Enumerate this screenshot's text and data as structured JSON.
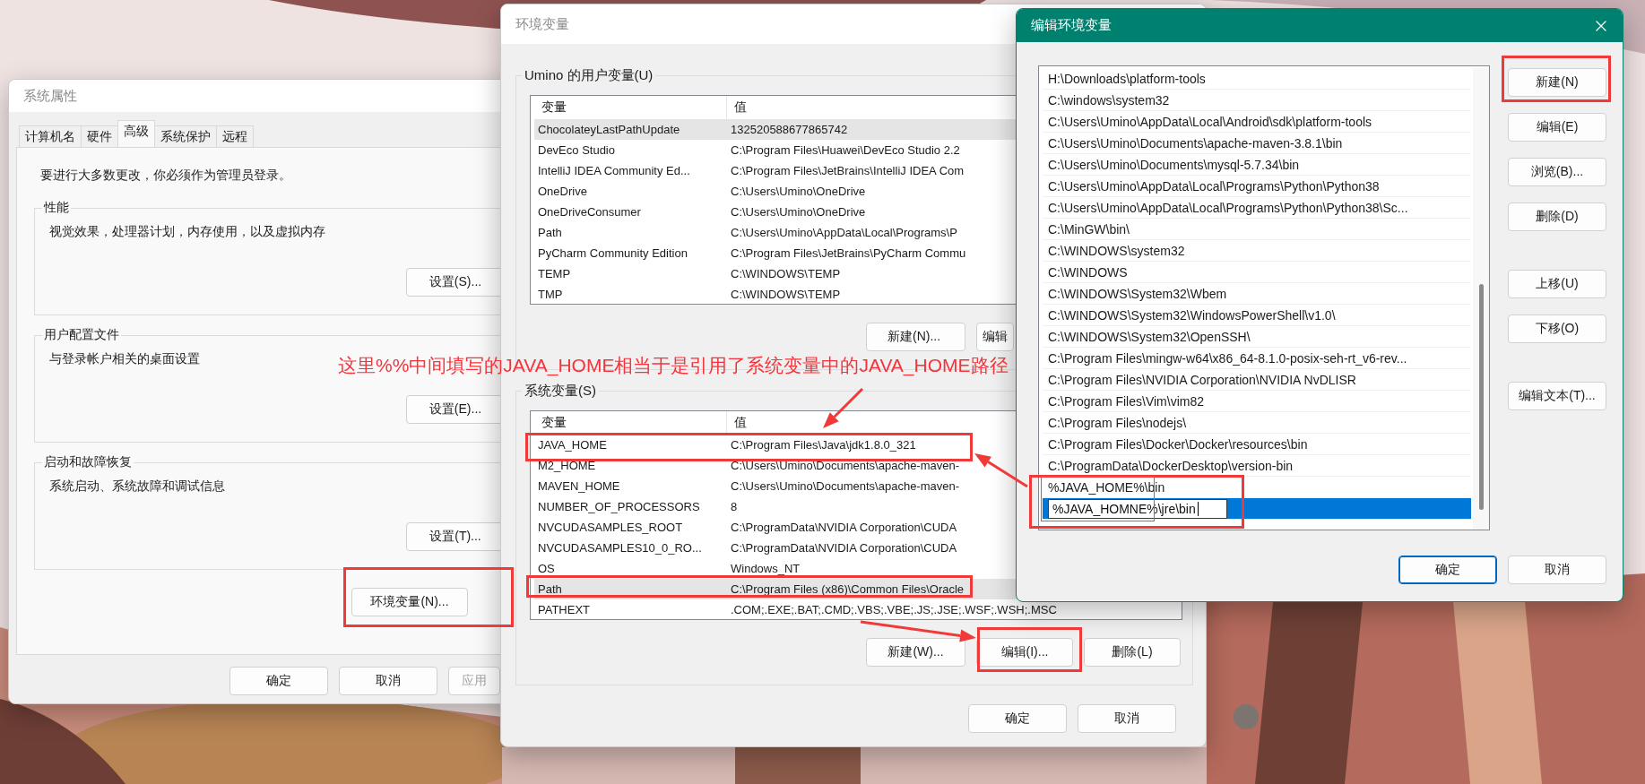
{
  "system_properties": {
    "title": "系统属性",
    "tabs": [
      {
        "label": "计算机名",
        "selected": false
      },
      {
        "label": "硬件",
        "selected": false
      },
      {
        "label": "高级",
        "selected": true
      },
      {
        "label": "系统保护",
        "selected": false
      },
      {
        "label": "远程",
        "selected": false
      }
    ],
    "notice": "要进行大多数更改，你必须作为管理员登录。",
    "groups": [
      {
        "title": "性能",
        "description": "视觉效果，处理器计划，内存使用，以及虚拟内存",
        "button": "设置(S)..."
      },
      {
        "title": "用户配置文件",
        "description": "与登录帐户相关的桌面设置",
        "button": "设置(E)..."
      },
      {
        "title": "启动和故障恢复",
        "description": "系统启动、系统故障和调试信息",
        "button": "设置(T)..."
      }
    ],
    "env_button": "环境变量(N)...",
    "buttons": [
      {
        "label": "确定",
        "disabled": false
      },
      {
        "label": "取消",
        "disabled": false
      },
      {
        "label": "应用",
        "disabled": true
      }
    ]
  },
  "environment_variables": {
    "title": "环境变量",
    "user_variables": {
      "label": "Umino 的用户变量(U)",
      "columns": [
        "变量",
        "值"
      ],
      "rows": [
        {
          "name": "ChocolateyLastPathUpdate",
          "value": "132520588677865742",
          "selected": true
        },
        {
          "name": "DevEco Studio",
          "value": "C:\\Program Files\\Huawei\\DevEco Studio 2.2",
          "selected": false
        },
        {
          "name": "IntelliJ IDEA Community Ed...",
          "value": "C:\\Program Files\\JetBrains\\IntelliJ IDEA Com",
          "selected": false
        },
        {
          "name": "OneDrive",
          "value": "C:\\Users\\Umino\\OneDrive",
          "selected": false
        },
        {
          "name": "OneDriveConsumer",
          "value": "C:\\Users\\Umino\\OneDrive",
          "selected": false
        },
        {
          "name": "Path",
          "value": "C:\\Users\\Umino\\AppData\\Local\\Programs\\P",
          "selected": false
        },
        {
          "name": "PyCharm Community Edition",
          "value": "C:\\Program Files\\JetBrains\\PyCharm Commu",
          "selected": false
        },
        {
          "name": "TEMP",
          "value": "C:\\WINDOWS\\TEMP",
          "selected": false
        },
        {
          "name": "TMP",
          "value": "C:\\WINDOWS\\TEMP",
          "selected": false
        }
      ],
      "buttons": [
        "新建(N)...",
        "编辑"
      ]
    },
    "system_variables": {
      "label": "系统变量(S)",
      "columns": [
        "变量",
        "值"
      ],
      "rows": [
        {
          "name": "JAVA_HOME",
          "value": "C:\\Program Files\\Java\\jdk1.8.0_321",
          "selected": false
        },
        {
          "name": "M2_HOME",
          "value": "C:\\Users\\Umino\\Documents\\apache-maven-",
          "selected": false
        },
        {
          "name": "MAVEN_HOME",
          "value": "C:\\Users\\Umino\\Documents\\apache-maven-",
          "selected": false
        },
        {
          "name": "NUMBER_OF_PROCESSORS",
          "value": "8",
          "selected": false
        },
        {
          "name": "NVCUDASAMPLES_ROOT",
          "value": "C:\\ProgramData\\NVIDIA Corporation\\CUDA",
          "selected": false
        },
        {
          "name": "NVCUDASAMPLES10_0_RO...",
          "value": "C:\\ProgramData\\NVIDIA Corporation\\CUDA",
          "selected": false
        },
        {
          "name": "OS",
          "value": "Windows_NT",
          "selected": false
        },
        {
          "name": "Path",
          "value": "C:\\Program Files (x86)\\Common Files\\Oracle",
          "selected": true
        },
        {
          "name": "PATHEXT",
          "value": ".COM;.EXE;.BAT;.CMD;.VBS;.VBE;.JS;.JSE;.WSF;.WSH;.MSC",
          "selected": false
        }
      ],
      "buttons": [
        "新建(W)...",
        "编辑(I)...",
        "删除(L)"
      ]
    },
    "buttons": [
      "确定",
      "取消"
    ]
  },
  "edit_dialog": {
    "title": "编辑环境变量",
    "entries": [
      {
        "text": "H:\\Downloads\\platform-tools",
        "selected": false,
        "editing": false
      },
      {
        "text": "C:\\windows\\system32",
        "selected": false,
        "editing": false
      },
      {
        "text": "C:\\Users\\Umino\\AppData\\Local\\Android\\sdk\\platform-tools",
        "selected": false,
        "editing": false
      },
      {
        "text": "C:\\Users\\Umino\\Documents\\apache-maven-3.8.1\\bin",
        "selected": false,
        "editing": false
      },
      {
        "text": "C:\\Users\\Umino\\Documents\\mysql-5.7.34\\bin",
        "selected": false,
        "editing": false
      },
      {
        "text": "C:\\Users\\Umino\\AppData\\Local\\Programs\\Python\\Python38",
        "selected": false,
        "editing": false
      },
      {
        "text": "C:\\Users\\Umino\\AppData\\Local\\Programs\\Python\\Python38\\Sc...",
        "selected": false,
        "editing": false
      },
      {
        "text": "C:\\MinGW\\bin\\",
        "selected": false,
        "editing": false
      },
      {
        "text": "C:\\WINDOWS\\system32",
        "selected": false,
        "editing": false
      },
      {
        "text": "C:\\WINDOWS",
        "selected": false,
        "editing": false
      },
      {
        "text": "C:\\WINDOWS\\System32\\Wbem",
        "selected": false,
        "editing": false
      },
      {
        "text": "C:\\WINDOWS\\System32\\WindowsPowerShell\\v1.0\\",
        "selected": false,
        "editing": false
      },
      {
        "text": "C:\\WINDOWS\\System32\\OpenSSH\\",
        "selected": false,
        "editing": false
      },
      {
        "text": "C:\\Program Files\\mingw-w64\\x86_64-8.1.0-posix-seh-rt_v6-rev...",
        "selected": false,
        "editing": false
      },
      {
        "text": "C:\\Program Files\\NVIDIA Corporation\\NVIDIA NvDLISR",
        "selected": false,
        "editing": false
      },
      {
        "text": "C:\\Program Files\\Vim\\vim82",
        "selected": false,
        "editing": false
      },
      {
        "text": "C:\\Program Files\\nodejs\\",
        "selected": false,
        "editing": false
      },
      {
        "text": "C:\\Program Files\\Docker\\Docker\\resources\\bin",
        "selected": false,
        "editing": false
      },
      {
        "text": "C:\\ProgramData\\DockerDesktop\\version-bin",
        "selected": false,
        "editing": false
      },
      {
        "text": "%JAVA_HOME%\\bin",
        "selected": false,
        "editing": false
      },
      {
        "text": "%JAVA_HOMNE%\\jre\\bin",
        "selected": true,
        "editing": true
      }
    ],
    "button_groups": [
      [
        "新建(N)",
        "编辑(E)",
        "浏览(B)...",
        "删除(D)"
      ],
      [
        "上移(U)",
        "下移(O)"
      ],
      [
        "编辑文本(T)..."
      ]
    ],
    "footer_buttons": [
      {
        "label": "确定",
        "default": true
      },
      {
        "label": "取消",
        "default": false
      }
    ]
  },
  "annotation": {
    "note": "这里%%中间填写的JAVA_HOME相当于是引用了系统变量中的JAVA_HOME路径"
  }
}
